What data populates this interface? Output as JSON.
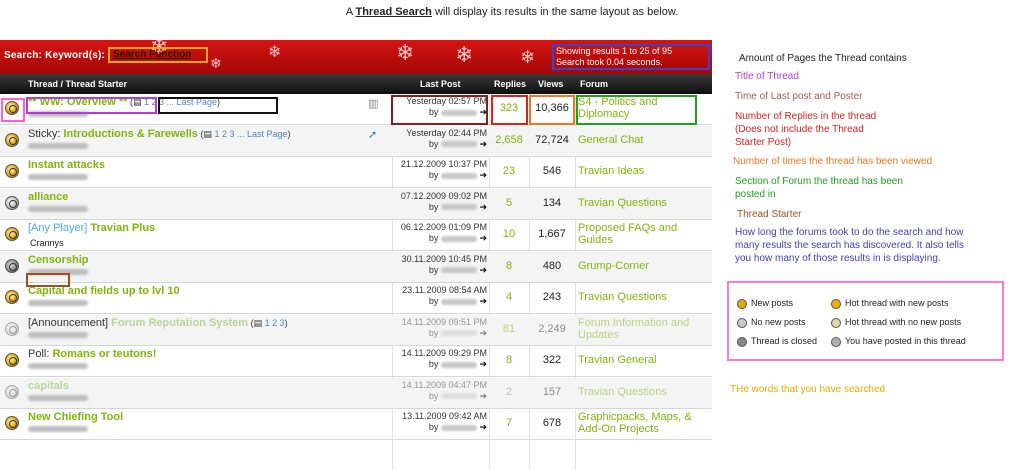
{
  "caption": {
    "prefix": "A ",
    "highlight": "Thread Search",
    "suffix": " will display its results in the same layout as below."
  },
  "banner": {
    "search_label": "Search: Keyword(s):",
    "search_terms": "Search Function",
    "results_line1": "Showing results 1 to 25 of 95",
    "results_line2": "Search took 0.04 seconds."
  },
  "table": {
    "headers": {
      "thread": "Thread / Thread Starter",
      "lastpost": "Last Post",
      "replies": "Replies",
      "views": "Views",
      "forum": "Forum"
    },
    "rows": [
      {
        "status": "hot-new",
        "prefix": "",
        "title": "** WW: Overview **",
        "pages": "1 2 3 ... Last Page",
        "lastpost_time": "Yesterday 02:57 PM",
        "by": "by",
        "replies": "323",
        "views": "10,366",
        "forum": "S4 - Politics and Diplomacy"
      },
      {
        "status": "hot-new",
        "prefix": "Sticky: ",
        "title": "Introductions & Farewells",
        "pages": "1 2 3 ... Last Page",
        "lastpost_time": "Yesterday 02:44 PM",
        "by": "by",
        "replies": "2,658",
        "views": "72,724",
        "forum": "General Chat"
      },
      {
        "status": "hot-new",
        "prefix": "",
        "title": "Instant attacks",
        "pages": "",
        "lastpost_time": "21.12.2009 10:37 PM",
        "by": "by",
        "replies": "23",
        "views": "546",
        "forum": "Travian Ideas"
      },
      {
        "status": "no-new",
        "prefix": "",
        "title": "alliance",
        "pages": "",
        "lastpost_time": "07.12.2009 09:02 PM",
        "by": "by",
        "replies": "5",
        "views": "134",
        "forum": "Travian Questions"
      },
      {
        "status": "hot-new",
        "prefix": "[Any Player] ",
        "title": "Travian Plus",
        "pages": "",
        "lastpost_time": "06.12.2009 01:09 PM",
        "by": "by",
        "replies": "10",
        "views": "1,667",
        "forum": "Proposed FAQs and Guides",
        "starter": "Crannys"
      },
      {
        "status": "closed",
        "prefix": "",
        "title": "Censorship",
        "pages": "",
        "lastpost_time": "30.11.2009 10:45 PM",
        "by": "by",
        "replies": "8",
        "views": "480",
        "forum": "Grump-Corner"
      },
      {
        "status": "hot-new",
        "prefix": "",
        "title": "Capital and fields up to lvl 10",
        "pages": "",
        "lastpost_time": "23.11.2009 08:54 AM",
        "by": "by",
        "replies": "4",
        "views": "243",
        "forum": "Travian Questions"
      },
      {
        "status": "hot-no-new",
        "prefix": "[Announcement] ",
        "title": "Forum Reputation System",
        "pages": "1 2 3",
        "lastpost_time": "14.11.2009 09:51 PM",
        "by": "by",
        "replies": "81",
        "views": "2,249",
        "forum": "Forum Information and Updates"
      },
      {
        "status": "hot-new",
        "prefix": "Poll: ",
        "title": "Romans or teutons!",
        "pages": "",
        "lastpost_time": "14.11.2009 09:29 PM",
        "by": "by",
        "replies": "8",
        "views": "322",
        "forum": "Travian General"
      },
      {
        "status": "hot-no-new",
        "prefix": "",
        "title": "capitals",
        "pages": "",
        "lastpost_time": "14.11.2009 04:47 PM",
        "by": "by",
        "replies": "2",
        "views": "157",
        "forum": "Travian Questions"
      },
      {
        "status": "hot-new",
        "prefix": "",
        "title": "New Chiefing Tool",
        "pages": "",
        "lastpost_time": "13.11.2009 09:42 AM",
        "by": "by",
        "replies": "7",
        "views": "678",
        "forum": "Graphicpacks, Maps, & Add-On Projects"
      }
    ]
  },
  "legend": {
    "pages": "Amount of Pages the Thread contains",
    "title": "Title of Thread",
    "lastpost": "Time of Last post and Poster",
    "replies1": "Number of Replies in the thread",
    "replies2": "(Does not include the Thread",
    "replies3": "Starter Post)",
    "views": "Number of times the thread has been viewed",
    "forum1": "Section of Forum the thread has been",
    "forum2": "posted in",
    "starter": "Thread Starter",
    "search1": "How long the forums took to do the search and how",
    "search2": "many results the search has discovered. It also tells",
    "search3": "you how many of those results in is displaying.",
    "icons": {
      "new": "New posts",
      "hot_new": "Hot thread with new posts",
      "no_new": "No new posts",
      "hot_no_new": "Hot thread with no new posts",
      "closed": "Thread is closed",
      "posted": "You have posted in this thread"
    },
    "words": "THe words that you have searched"
  },
  "colors": {
    "title_green": "#7fb50a",
    "banner_red": "#c20c0c",
    "pages_box": "#000000",
    "title_box": "#b040d0",
    "lastpost_box": "#8b1a1a",
    "replies_box": "#e02020",
    "views_box": "#f07820",
    "forum_box": "#20a020",
    "starter_box": "#a05020",
    "search_box": "#4040c0",
    "terms_box": "#f5a800",
    "icon_box": "#ff5fd8"
  }
}
